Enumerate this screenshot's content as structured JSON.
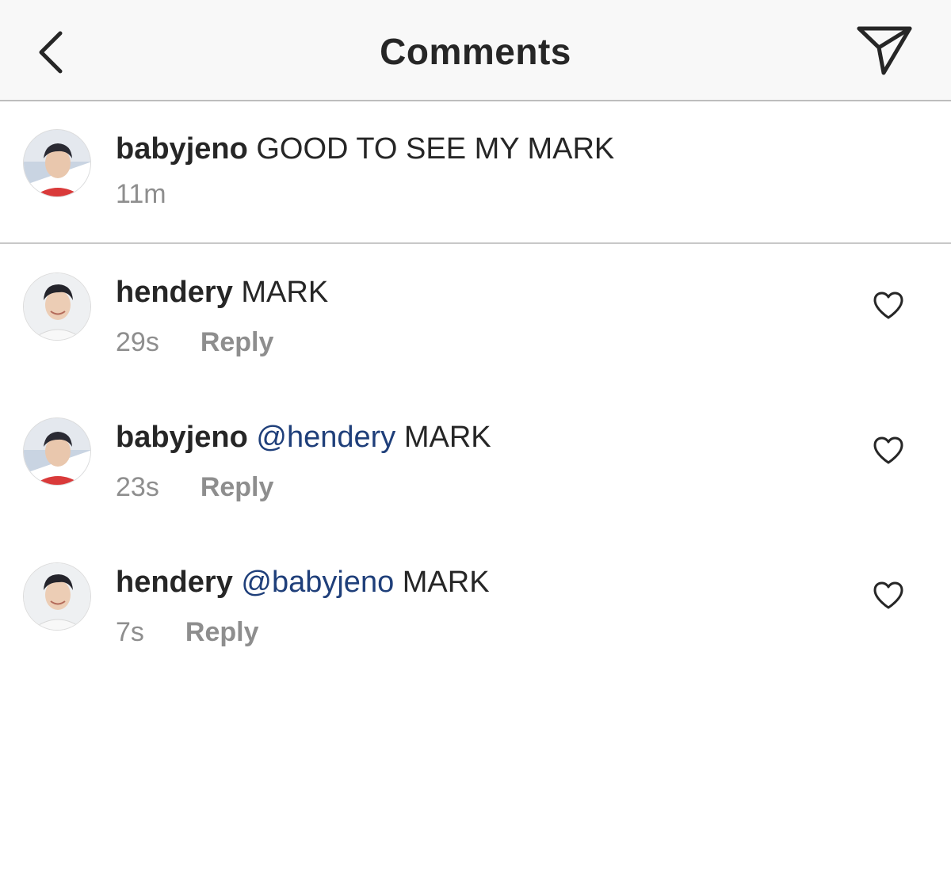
{
  "header": {
    "title": "Comments",
    "back_icon": "chevron-left-icon",
    "share_icon": "paper-plane-icon"
  },
  "caption": {
    "username": "babyjeno",
    "text": "GOOD TO SEE MY MARK",
    "time": "11m"
  },
  "comments": [
    {
      "username": "hendery",
      "mention": "",
      "text": "MARK",
      "time": "29s",
      "reply_label": "Reply"
    },
    {
      "username": "babyjeno",
      "mention": "@hendery",
      "text": "MARK",
      "time": "23s",
      "reply_label": "Reply"
    },
    {
      "username": "hendery",
      "mention": "@babyjeno",
      "text": "MARK",
      "time": "7s",
      "reply_label": "Reply"
    }
  ],
  "colors": {
    "header_bg": "#f8f8f8",
    "text": "#262626",
    "muted": "#8e8e8e",
    "mention": "#1f3f7a"
  }
}
